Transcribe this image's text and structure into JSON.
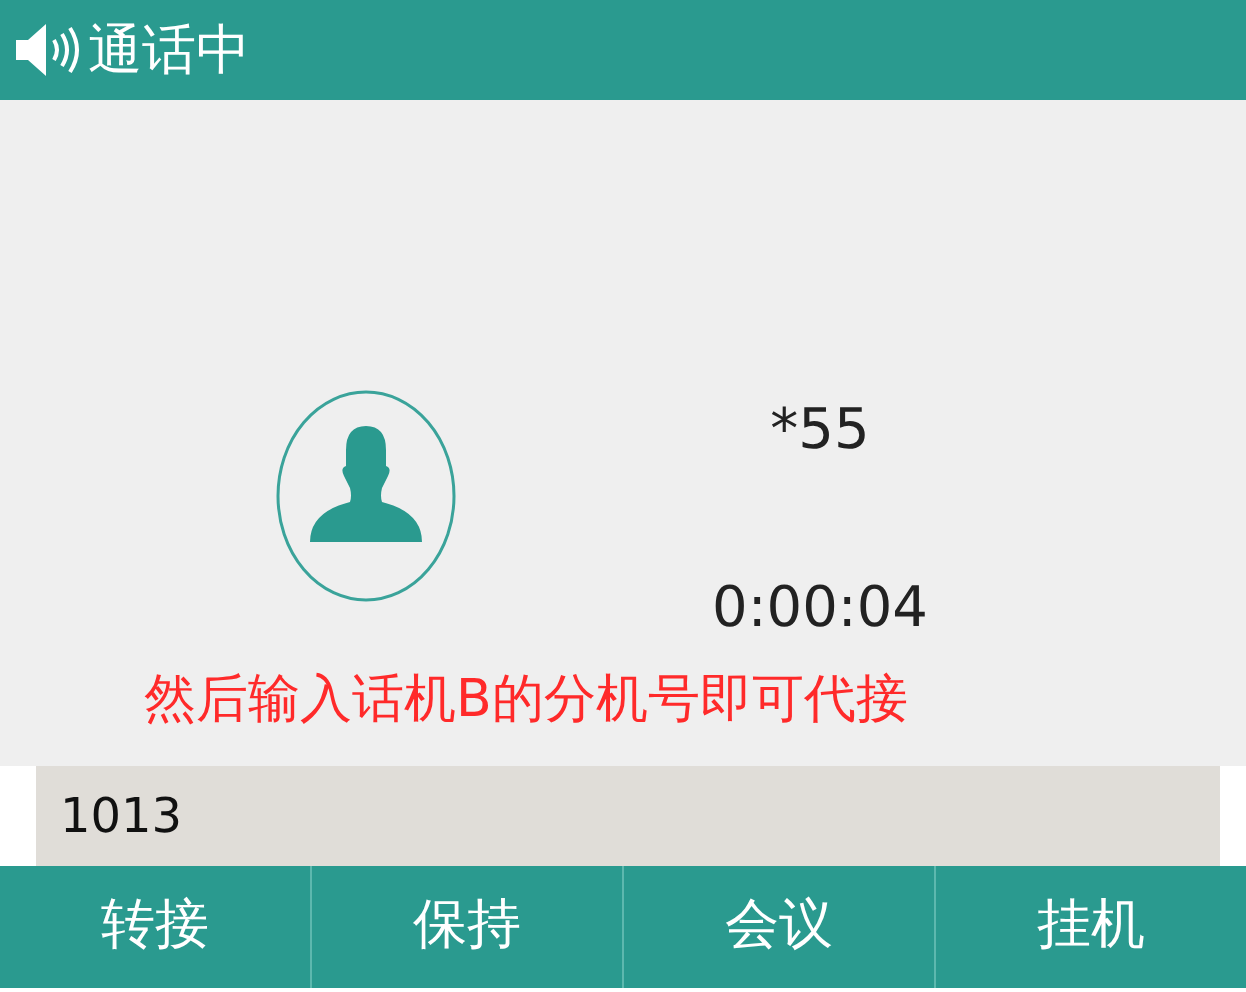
{
  "header": {
    "title": "通话中"
  },
  "call": {
    "number": "*55",
    "duration": "0:00:04"
  },
  "annotation": "然后输入话机B的分机号即可代接",
  "input": {
    "value": "1013"
  },
  "softkeys": [
    "转接",
    "保持",
    "会议",
    "挂机"
  ]
}
